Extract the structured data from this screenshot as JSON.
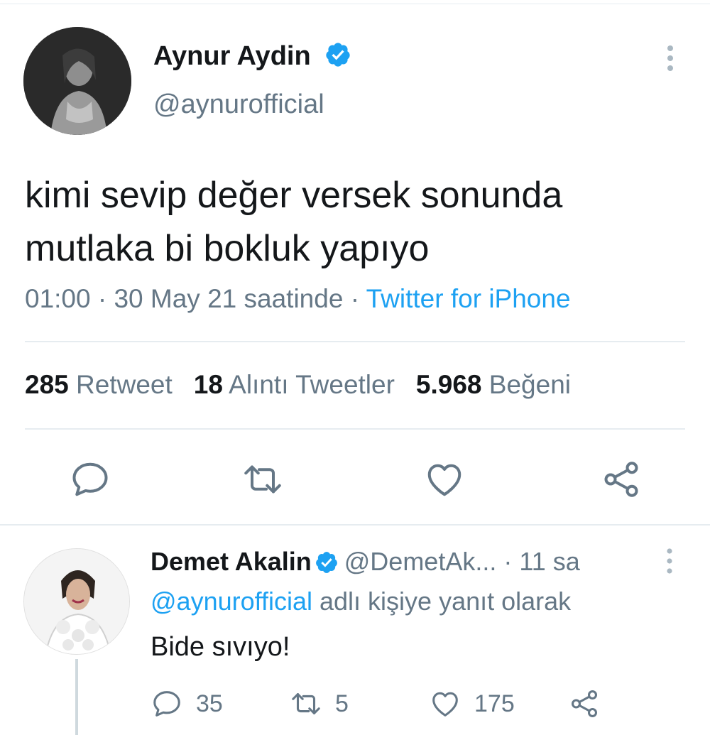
{
  "tweet": {
    "author_name": "Aynur Aydin",
    "author_handle": "@aynurofficial",
    "text": "kimi sevip değer versek sonunda mutlaka bi bokluk yapıyo",
    "time": "01:00 · 30 May 21 saatinde · ",
    "source": "Twitter for iPhone",
    "stats": {
      "retweets_count": "285",
      "retweets_label": "Retweet",
      "quotes_count": "18",
      "quotes_label": "Alıntı Tweetler",
      "likes_count": "5.968",
      "likes_label": "Beğeni"
    }
  },
  "reply": {
    "author_name": "Demet Akalin",
    "author_handle": "@DemetAk...",
    "time": "· 11 sa",
    "replying_mention": "@aynurofficial",
    "replying_suffix": " adlı kişiye yanıt olarak",
    "text": "Bide sıvıyo!",
    "reply_count": "35",
    "retweet_count": "5",
    "like_count": "175"
  },
  "colors": {
    "accent": "#1da1f2",
    "secondary_text": "#657786",
    "primary_text": "#14171a"
  },
  "icons": [
    "verified-badge-icon",
    "more-options-icon",
    "reply-icon",
    "retweet-icon",
    "like-icon",
    "share-icon"
  ]
}
